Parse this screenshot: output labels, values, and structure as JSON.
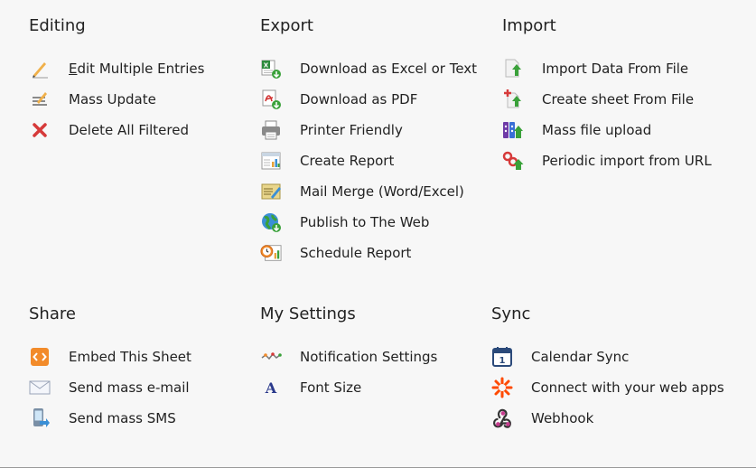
{
  "sections": {
    "editing": {
      "title": "Editing",
      "items": [
        {
          "first": "E",
          "rest": "dit Multiple Entries",
          "icon": "pencil-icon"
        },
        {
          "label": "Mass Update",
          "icon": "mass-update-icon"
        },
        {
          "label": "Delete All Filtered",
          "icon": "delete-icon"
        }
      ]
    },
    "export": {
      "title": "Export",
      "items": [
        {
          "label": "Download as Excel or Text",
          "icon": "excel-icon"
        },
        {
          "label": "Download as PDF",
          "icon": "pdf-icon"
        },
        {
          "label": "Printer Friendly",
          "icon": "printer-icon"
        },
        {
          "label": "Create Report",
          "icon": "report-icon"
        },
        {
          "label": "Mail Merge (Word/Excel)",
          "icon": "mail-merge-icon"
        },
        {
          "label": "Publish to The Web",
          "icon": "globe-icon"
        },
        {
          "label": "Schedule Report",
          "icon": "schedule-icon"
        }
      ]
    },
    "import": {
      "title": "Import",
      "items": [
        {
          "label": "Import Data From File",
          "icon": "import-file-icon"
        },
        {
          "label": "Create sheet From File",
          "icon": "create-sheet-icon"
        },
        {
          "label": "Mass file upload",
          "icon": "mass-upload-icon"
        },
        {
          "label": "Periodic import from URL",
          "icon": "url-import-icon"
        }
      ]
    },
    "share": {
      "title": "Share",
      "items": [
        {
          "label": "Embed This Sheet",
          "icon": "embed-icon"
        },
        {
          "label": "Send mass e-mail",
          "icon": "envelope-icon"
        },
        {
          "label": "Send mass SMS",
          "icon": "phone-icon"
        }
      ]
    },
    "settings": {
      "title": "My Settings",
      "items": [
        {
          "label": "Notification Settings",
          "icon": "notification-icon"
        },
        {
          "label": "Font Size",
          "icon": "font-icon"
        }
      ]
    },
    "sync": {
      "title": "Sync",
      "items": [
        {
          "label": "Calendar Sync",
          "icon": "calendar-icon",
          "calendar_day": "1"
        },
        {
          "label": "Connect with your web apps",
          "icon": "zapier-icon"
        },
        {
          "label": "Webhook",
          "icon": "webhook-icon"
        }
      ]
    }
  }
}
